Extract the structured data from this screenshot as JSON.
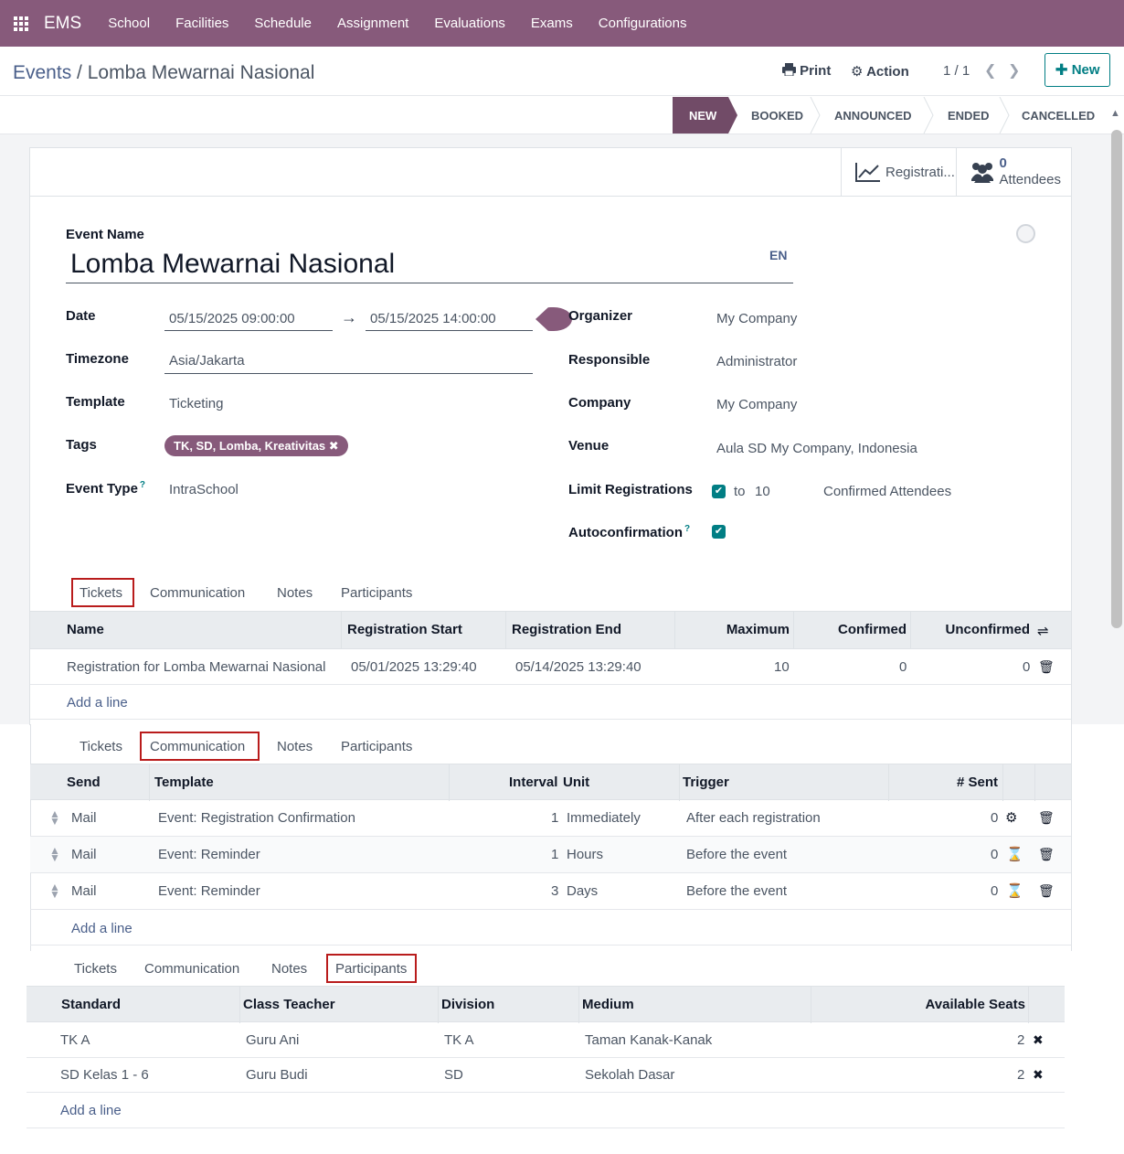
{
  "topbar": {
    "brand": "EMS",
    "menu": [
      "School",
      "Facilities",
      "Schedule",
      "Assignment",
      "Evaluations",
      "Exams",
      "Configurations"
    ]
  },
  "breadcrumb": {
    "parent": "Events",
    "separator": "/",
    "current": "Lomba Mewarnai Nasional"
  },
  "control": {
    "print": "Print",
    "action": "Action",
    "pager": "1 / 1",
    "new": "New"
  },
  "stages": [
    "NEW",
    "BOOKED",
    "ANNOUNCED",
    "ENDED",
    "CANCELLED"
  ],
  "smart": {
    "registrations": "Registrati...",
    "attendees_count": "0",
    "attendees": "Attendees"
  },
  "form": {
    "event_name_label": "Event Name",
    "event_name": "Lomba Mewarnai Nasional",
    "lang": "EN",
    "date_label": "Date",
    "date_start": "05/15/2025 09:00:00",
    "date_end": "05/15/2025 14:00:00",
    "timezone_label": "Timezone",
    "timezone": "Asia/Jakarta",
    "template_label": "Template",
    "template": "Ticketing",
    "tags_label": "Tags",
    "tag": "TK, SD, Lomba, Kreativitas",
    "event_type_label": "Event Type",
    "event_type": "IntraSchool",
    "help": "?",
    "organizer_label": "Organizer",
    "organizer": "My Company",
    "responsible_label": "Responsible",
    "responsible": "Administrator",
    "company_label": "Company",
    "company": "My Company",
    "venue_label": "Venue",
    "venue": "Aula SD My Company, Indonesia",
    "limit_label": "Limit Registrations",
    "limit_to": "to",
    "limit_value": "10",
    "limit_suffix": "Confirmed Attendees",
    "autoconf_label": "Autoconfirmation"
  },
  "tabs": [
    "Tickets",
    "Communication",
    "Notes",
    "Participants"
  ],
  "tickets": {
    "headers": [
      "Name",
      "Registration Start",
      "Registration End",
      "Maximum",
      "Confirmed",
      "Unconfirmed"
    ],
    "rows": [
      [
        "Registration for Lomba Mewarnai Nasional",
        "05/01/2025 13:29:40",
        "05/14/2025 13:29:40",
        "10",
        "0",
        "0"
      ]
    ],
    "add": "Add a line"
  },
  "communication": {
    "headers": [
      "Send",
      "Template",
      "Interval",
      "Unit",
      "Trigger",
      "# Sent"
    ],
    "rows": [
      [
        "Mail",
        "Event: Registration Confirmation",
        "1",
        "Immediately",
        "After each registration",
        "0"
      ],
      [
        "Mail",
        "Event: Reminder",
        "1",
        "Hours",
        "Before the event",
        "0"
      ],
      [
        "Mail",
        "Event: Reminder",
        "3",
        "Days",
        "Before the event",
        "0"
      ]
    ],
    "add": "Add a line"
  },
  "participants": {
    "headers": [
      "Standard",
      "Class Teacher",
      "Division",
      "Medium",
      "Available Seats"
    ],
    "rows": [
      [
        "TK A",
        "Guru Ani",
        "TK A",
        "Taman Kanak-Kanak",
        "2"
      ],
      [
        "SD Kelas 1 - 6",
        "Guru Budi",
        "SD",
        "Sekolah Dasar",
        "2"
      ]
    ],
    "add": "Add a line"
  },
  "colors": {
    "brand": "#875a7b",
    "stage_active": "#714b67",
    "accent": "#017e84"
  }
}
